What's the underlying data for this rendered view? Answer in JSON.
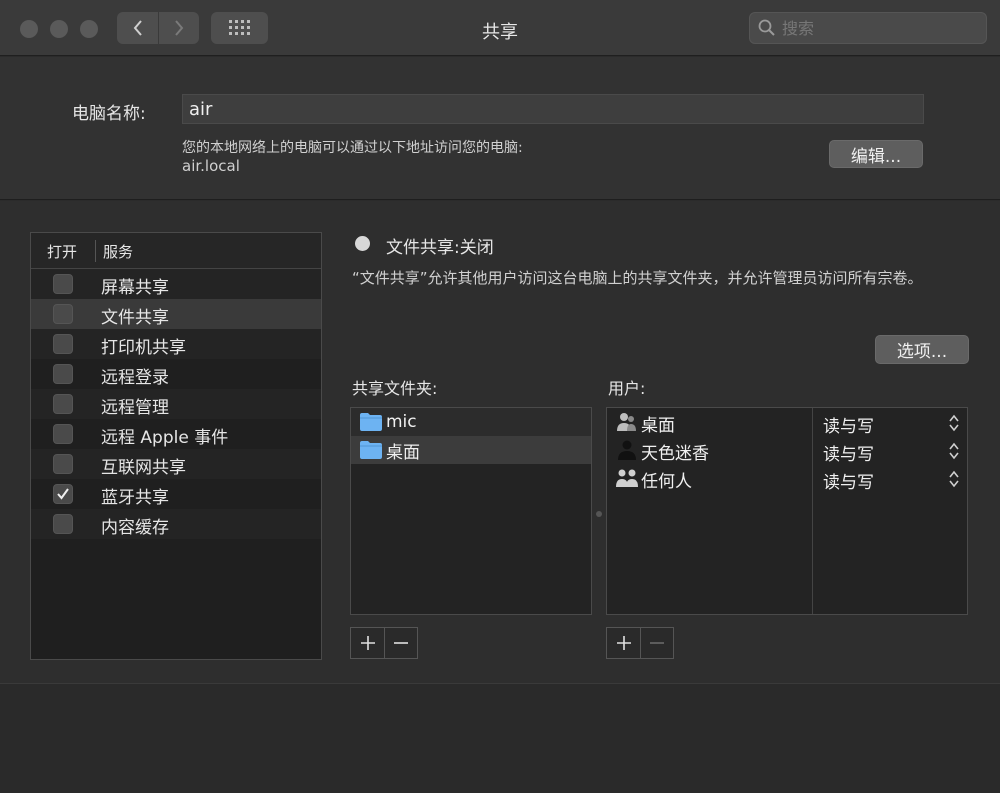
{
  "window": {
    "title": "共享",
    "search_placeholder": "搜索"
  },
  "computer_name": {
    "label": "电脑名称:",
    "value": "air",
    "description": "您的本地网络上的电脑可以通过以下地址访问您的电脑:",
    "address": "air.local",
    "edit_label": "编辑..."
  },
  "services": {
    "header_open": "打开",
    "header_service": "服务",
    "items": [
      {
        "label": "屏幕共享",
        "checked": false
      },
      {
        "label": "文件共享",
        "checked": false,
        "selected": true
      },
      {
        "label": "打印机共享",
        "checked": false
      },
      {
        "label": "远程登录",
        "checked": false
      },
      {
        "label": "远程管理",
        "checked": false
      },
      {
        "label": "远程 Apple 事件",
        "checked": false
      },
      {
        "label": "互联网共享",
        "checked": false
      },
      {
        "label": "蓝牙共享",
        "checked": true
      },
      {
        "label": "内容缓存",
        "checked": false
      }
    ]
  },
  "detail": {
    "status": "文件共享:关闭",
    "description": "“文件共享”允许其他用户访问这台电脑上的共享文件夹，并允许管理员访问所有宗卷。",
    "options_label": "选项...",
    "shared_folders_label": "共享文件夹:",
    "users_label": "用户:",
    "folders": [
      {
        "name": "mic",
        "icon": "folder-icon"
      },
      {
        "name": "桌面",
        "icon": "folder-icon"
      }
    ],
    "users": [
      {
        "name": "桌面",
        "permission": "读与写",
        "icon": "user-group-icon"
      },
      {
        "name": "天色迷香",
        "permission": "读与写",
        "icon": "user-icon"
      },
      {
        "name": "任何人",
        "permission": "读与写",
        "icon": "everyone-icon"
      }
    ]
  },
  "colors": {
    "folder_blue": "#6db3f2",
    "background": "#2b2b2b",
    "titlebar": "#3a3a3a"
  }
}
